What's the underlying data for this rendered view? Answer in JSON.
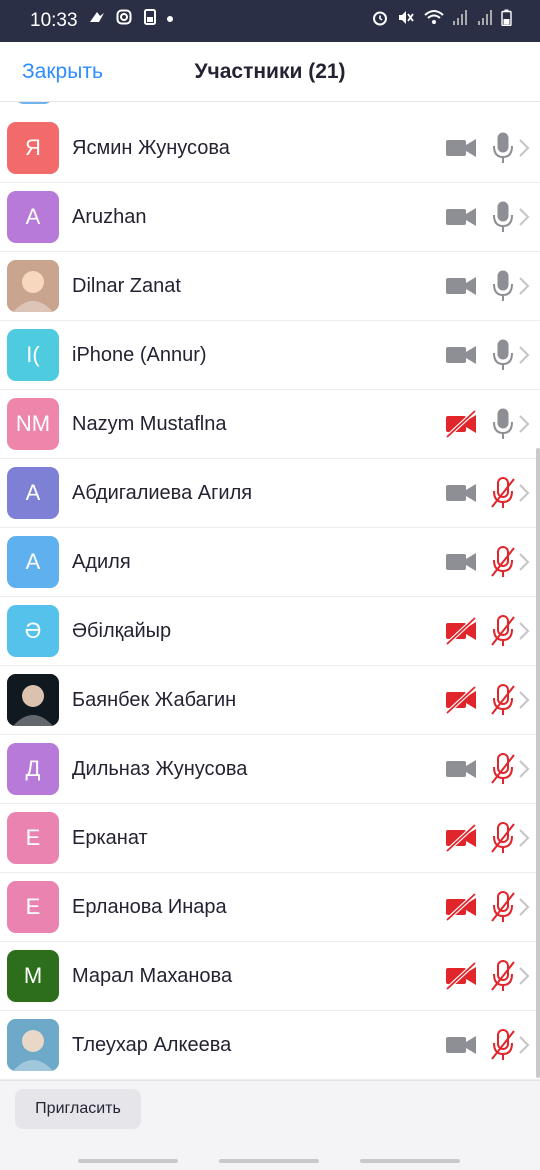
{
  "status_bar": {
    "time": "10:33",
    "left_icons": [
      "notification-icon",
      "instagram-icon",
      "sim-icon"
    ],
    "right_icons": [
      "alarm-icon",
      "mute-icon",
      "wifi-icon",
      "signal-icon",
      "signal-icon",
      "battery-icon"
    ]
  },
  "header": {
    "close_label": "Закрыть",
    "title": "Участники (21)"
  },
  "colors": {
    "accent": "#2d8cff",
    "muted_red": "#e0252b",
    "icon_gray": "#8e8e95"
  },
  "participants": [
    {
      "name": "Ясмин Жунусова",
      "initials": "Я",
      "avatar_color": "#f26a6a",
      "video_off": false,
      "audio_muted": false
    },
    {
      "name": "Aruzhan",
      "initials": "A",
      "avatar_color": "#b77ad9",
      "video_off": false,
      "audio_muted": false
    },
    {
      "name": "Dilnar Zanat",
      "initials": "",
      "avatar_photo": true,
      "avatar_color": "#c9a58f",
      "video_off": false,
      "audio_muted": false
    },
    {
      "name": "iPhone (Annur)",
      "initials": "I(",
      "avatar_color": "#4fcbe0",
      "video_off": false,
      "audio_muted": false
    },
    {
      "name": "Nazym Mustaflna",
      "initials": "NM",
      "avatar_color": "#ee86ab",
      "video_off": true,
      "audio_muted": false
    },
    {
      "name": "Абдигалиева Агиля",
      "initials": "A",
      "avatar_color": "#7d80d4",
      "video_off": false,
      "audio_muted": true
    },
    {
      "name": "Адиля",
      "initials": "A",
      "avatar_color": "#5fb0ef",
      "video_off": false,
      "audio_muted": true
    },
    {
      "name": "Әбілқайыр",
      "initials": "Ә",
      "avatar_color": "#55c2ec",
      "video_off": true,
      "audio_muted": true
    },
    {
      "name": "Баянбек Жабагин",
      "initials": "",
      "avatar_photo": true,
      "avatar_color": "#101820",
      "video_off": true,
      "audio_muted": true
    },
    {
      "name": "Дильназ Жунусова",
      "initials": "Д",
      "avatar_color": "#b77ad9",
      "video_off": false,
      "audio_muted": true
    },
    {
      "name": "Ерканат",
      "initials": "E",
      "avatar_color": "#ea83b0",
      "video_off": true,
      "audio_muted": true
    },
    {
      "name": "Ерланова Инара",
      "initials": "E",
      "avatar_color": "#ea83b0",
      "video_off": true,
      "audio_muted": true
    },
    {
      "name": "Марал Маханова",
      "initials": "M",
      "avatar_color": "#2c6e1c",
      "video_off": true,
      "audio_muted": true
    },
    {
      "name": "Тлеухар Алкеева",
      "initials": "",
      "avatar_photo": true,
      "avatar_color": "#6fa9c9",
      "video_off": false,
      "audio_muted": true
    }
  ],
  "footer": {
    "invite_label": "Пригласить"
  }
}
